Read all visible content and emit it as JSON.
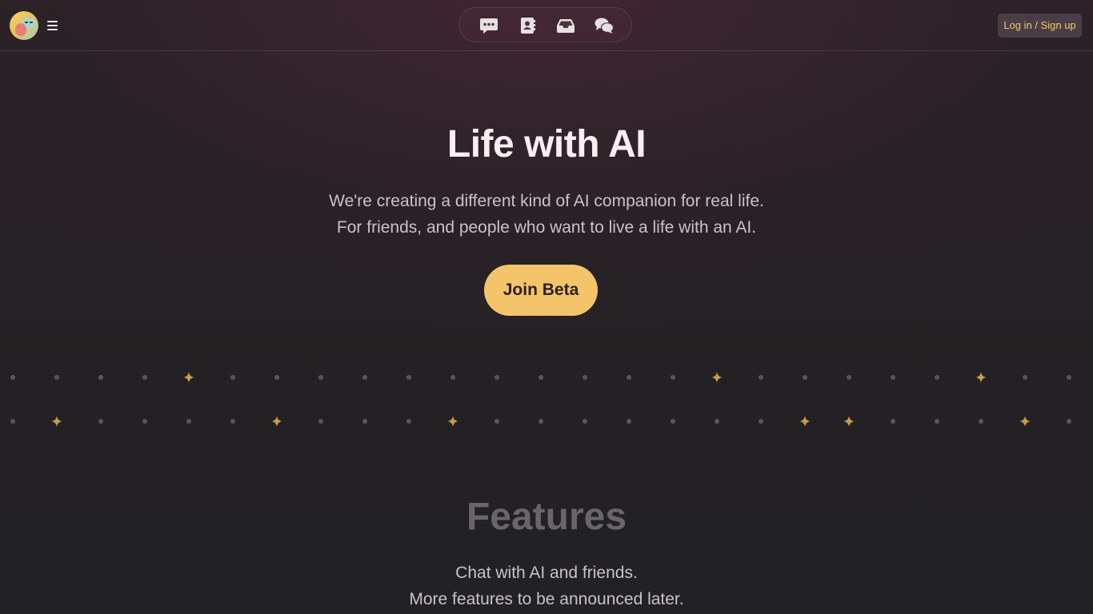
{
  "header": {
    "nav_icons": [
      "chat-bubble-icon",
      "contact-book-icon",
      "inbox-icon",
      "conversations-icon"
    ],
    "login_label": "Log in / Sign up"
  },
  "hero": {
    "title": "Life with AI",
    "subtitle_line1": "We're creating a different kind of AI companion for real life.",
    "subtitle_line2": "For friends, and people who want to live a life with an AI.",
    "cta_label": "Join Beta"
  },
  "features": {
    "title": "Features",
    "line1": "Chat with AI and friends.",
    "line2": "More features to be announced later."
  },
  "colors": {
    "accent": "#f4c46b",
    "star": "#c99a4b",
    "dot": "#5c5558",
    "background": "#262226"
  }
}
